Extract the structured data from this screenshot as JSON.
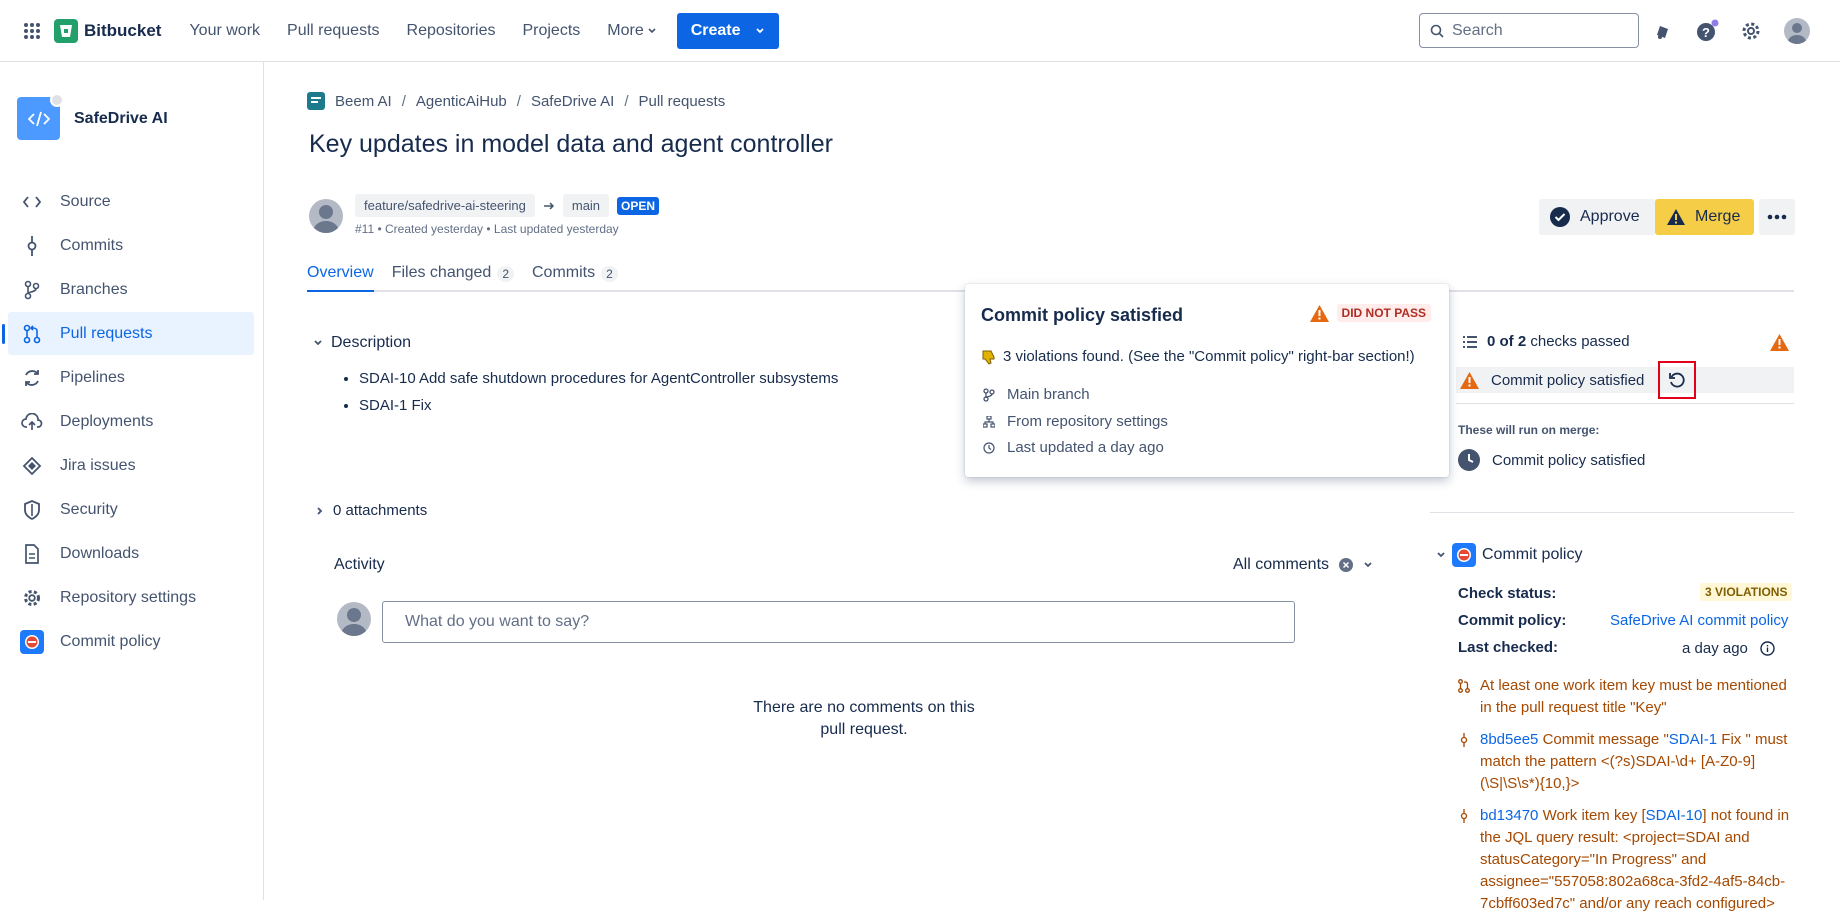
{
  "topnav": {
    "brand": "Bitbucket",
    "links": [
      "Your work",
      "Pull requests",
      "Repositories",
      "Projects"
    ],
    "more_label": "More",
    "create_label": "Create",
    "search_placeholder": "Search",
    "brand_color": "#22a06b",
    "accent": "#0c66e4"
  },
  "sidebar": {
    "repo_name": "SafeDrive AI",
    "items": [
      {
        "label": "Source",
        "icon": "code-icon"
      },
      {
        "label": "Commits",
        "icon": "commit-icon"
      },
      {
        "label": "Branches",
        "icon": "branch-icon"
      },
      {
        "label": "Pull requests",
        "icon": "pull-request-icon",
        "active": true
      },
      {
        "label": "Pipelines",
        "icon": "pipelines-icon"
      },
      {
        "label": "Deployments",
        "icon": "deployments-icon"
      },
      {
        "label": "Jira issues",
        "icon": "jira-icon"
      },
      {
        "label": "Security",
        "icon": "shield-icon"
      },
      {
        "label": "Downloads",
        "icon": "file-icon"
      },
      {
        "label": "Repository settings",
        "icon": "gear-icon"
      },
      {
        "label": "Commit policy",
        "icon": "commit-policy-icon"
      }
    ]
  },
  "breadcrumb": [
    "Beem AI",
    "AgenticAiHub",
    "SafeDrive AI",
    "Pull requests"
  ],
  "pr": {
    "title": "Key updates in model data and agent controller",
    "source_branch": "feature/safedrive-ai-steering",
    "target_branch": "main",
    "status": "OPEN",
    "meta": "#11 • Created yesterday • Last updated yesterday",
    "approve_label": "Approve",
    "merge_label": "Merge"
  },
  "tabs": [
    {
      "label": "Overview",
      "count": ""
    },
    {
      "label": "Files changed",
      "count": "2"
    },
    {
      "label": "Commits",
      "count": "2"
    }
  ],
  "description": {
    "heading": "Description",
    "items": [
      "SDAI-10 Add safe shutdown procedures for AgentController subsystems",
      "SDAI-1 Fix"
    ]
  },
  "attachments_label": "0 attachments",
  "activity": {
    "heading": "Activity",
    "filter_label": "All comments",
    "comment_placeholder": "What do you want to say?",
    "empty_line1": "There are no comments on this",
    "empty_line2": "pull request."
  },
  "popup": {
    "title": "Commit policy satisfied",
    "status": "DID NOT PASS",
    "violations": "3 violations found. (See the \"Commit policy\" right-bar section!)",
    "rows": [
      "Main branch",
      "From repository settings",
      "Last updated a day ago"
    ]
  },
  "checks": {
    "passed_bold": "0 of 2",
    "passed_rest": "checks passed",
    "check_name": "Commit policy satisfied",
    "run_on_merge_label": "These will run on merge:",
    "run_on_merge_item": "Commit policy satisfied"
  },
  "commit_policy": {
    "heading": "Commit policy",
    "check_status_label": "Check status:",
    "check_status_value": "3 VIOLATIONS",
    "policy_label": "Commit policy:",
    "policy_value": "SafeDrive AI commit policy",
    "last_checked_label": "Last checked:",
    "last_checked_value": "a day ago",
    "violation1": "At least one work item key must be mentioned in the pull request title \"Key\"",
    "violation2_hash": "8bd5ee5",
    "violation2_a": " Commit message \"",
    "violation2_key": "SDAI-1",
    "violation2_b": " Fix \" must match the pattern <(?s)SDAI-\\d+ [A-Z0-9](\\S|\\S\\s*){10,}>",
    "violation3_hash": "bd13470",
    "violation3_a": " Work item key [",
    "violation3_key": "SDAI-10",
    "violation3_b": "] not found in the JQL query result: <project=SDAI and statusCategory=\"In Progress\" and assignee=\"557058:802a68ca-3fd2-4af5-84cb-7cbff603ed7c\" and/or any reach configured>"
  }
}
